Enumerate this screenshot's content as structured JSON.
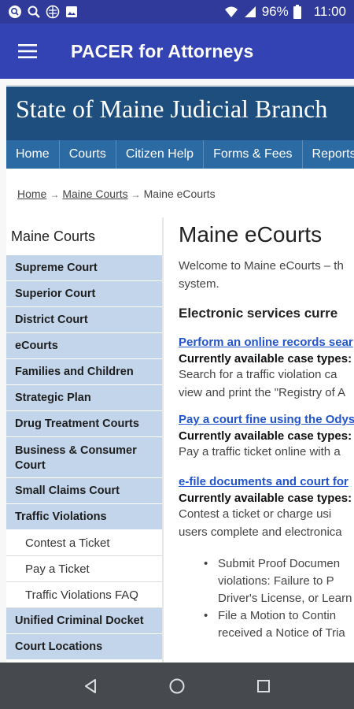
{
  "status_bar": {
    "battery": "96%",
    "time": "11:00",
    "icons": [
      "search-outline-icon",
      "search-icon",
      "vpn-icon",
      "image-icon",
      "wifi-icon",
      "signal-icon",
      "battery-icon"
    ]
  },
  "app_bar": {
    "title": "PACER for Attorneys"
  },
  "site": {
    "banner": "State of Maine Judicial Branch",
    "nav": [
      "Home",
      "Courts",
      "Citizen Help",
      "Forms & Fees",
      "Reports"
    ],
    "breadcrumb": [
      "Home",
      "Maine Courts",
      "Maine eCourts"
    ]
  },
  "sidebar": {
    "heading": "Maine Courts",
    "items": [
      "Supreme Court",
      "Superior Court",
      "District Court",
      "eCourts",
      "Families and Children",
      "Strategic Plan",
      "Drug Treatment Courts",
      "Business & Consumer Court",
      "Small Claims Court",
      "Traffic Violations"
    ],
    "subitems": [
      "Contest a Ticket",
      "Pay a Ticket",
      "Traffic Violations FAQ"
    ],
    "items_after": [
      "Unified Criminal Docket",
      "Court Locations"
    ]
  },
  "main": {
    "title": "Maine eCourts",
    "intro_line1": "Welcome to Maine eCourts – th",
    "intro_line2": "system.",
    "section_heading": "Electronic services curre",
    "services": [
      {
        "link": "Perform an online records sear",
        "case_types": "Currently available case types:",
        "lines": [
          "Search for a traffic violation ca",
          "view and print the \"Registry of A"
        ]
      },
      {
        "link": "Pay a court fine using the Odys",
        "case_types": "Currently available case types:",
        "lines": [
          "Pay a traffic ticket online with a"
        ]
      },
      {
        "link": "e-file documents and court for",
        "case_types": "Currently available case types:",
        "lines": [
          "Contest a ticket or charge usi",
          "users complete and electronica"
        ]
      }
    ],
    "bullets": [
      [
        "Submit Proof Documen",
        "violations: Failure to P",
        "Driver's License, or Learn"
      ],
      [
        "File a Motion to Contin",
        "received a Notice of Tria"
      ]
    ]
  },
  "colors": {
    "status_bar": "#2f3a9b",
    "app_bar": "#3443b3",
    "banner": "#1d4e7d",
    "topnav": "#2c6aa3",
    "sidebar_item": "#c3d5ea",
    "link": "#2255cc",
    "nav_bar": "#46494e"
  }
}
